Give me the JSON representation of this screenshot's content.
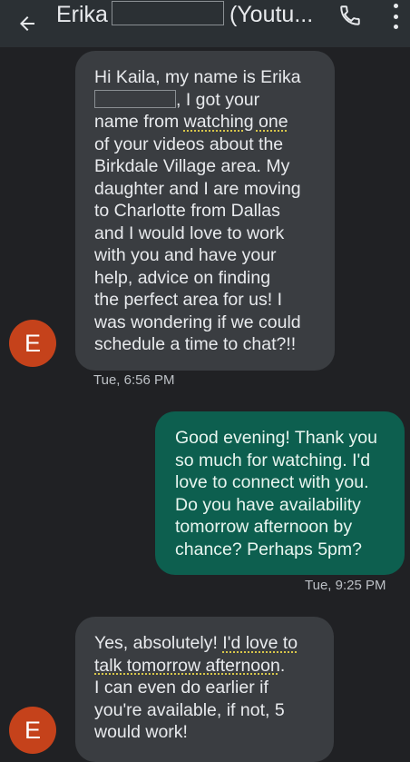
{
  "header": {
    "contact_name_start": "Erika",
    "contact_name_end": "(Youtu...",
    "back_icon": "arrow-left-icon",
    "call_icon": "phone-icon",
    "more_icon": "more-vert-icon"
  },
  "messages": [
    {
      "direction": "incoming",
      "segments": {
        "a": "Hi Kaila, my name is Erika\n",
        "b": ", I got your\nname from ",
        "c": "watching one",
        "d": "\nof your videos about the\nBirkdale Village area.  My\ndaughter and I are moving\nto Charlotte from Dallas\nand I would love to work\nwith you and have your\nhelp, advice on finding\nthe perfect area for us!  I\nwas wondering if we could\nschedule a time to chat?!!"
      },
      "timestamp": "Tue, 6:56 PM",
      "avatar_letter": "E"
    },
    {
      "direction": "outgoing",
      "text": "Good evening! Thank you\nso much for watching. I'd\nlove to connect with you.\nDo you have availability\ntomorrow afternoon by\nchance? Perhaps 5pm?",
      "timestamp": "Tue, 9:25 PM"
    },
    {
      "direction": "incoming",
      "segments": {
        "a": "Yes, absolutely!  ",
        "b": "I'd love to\ntalk tomorrow afternoon",
        "c": ".\nI can even do earlier if\nyou're available, if not, 5\nwould work!"
      },
      "avatar_letter": "E"
    }
  ],
  "colors": {
    "background": "#202124",
    "app_bar": "#2b3034",
    "incoming_bubble": "#3a3d41",
    "outgoing_bubble": "#0d5f4f",
    "avatar": "#c5421b",
    "underline_highlight": "#d8c64a"
  }
}
